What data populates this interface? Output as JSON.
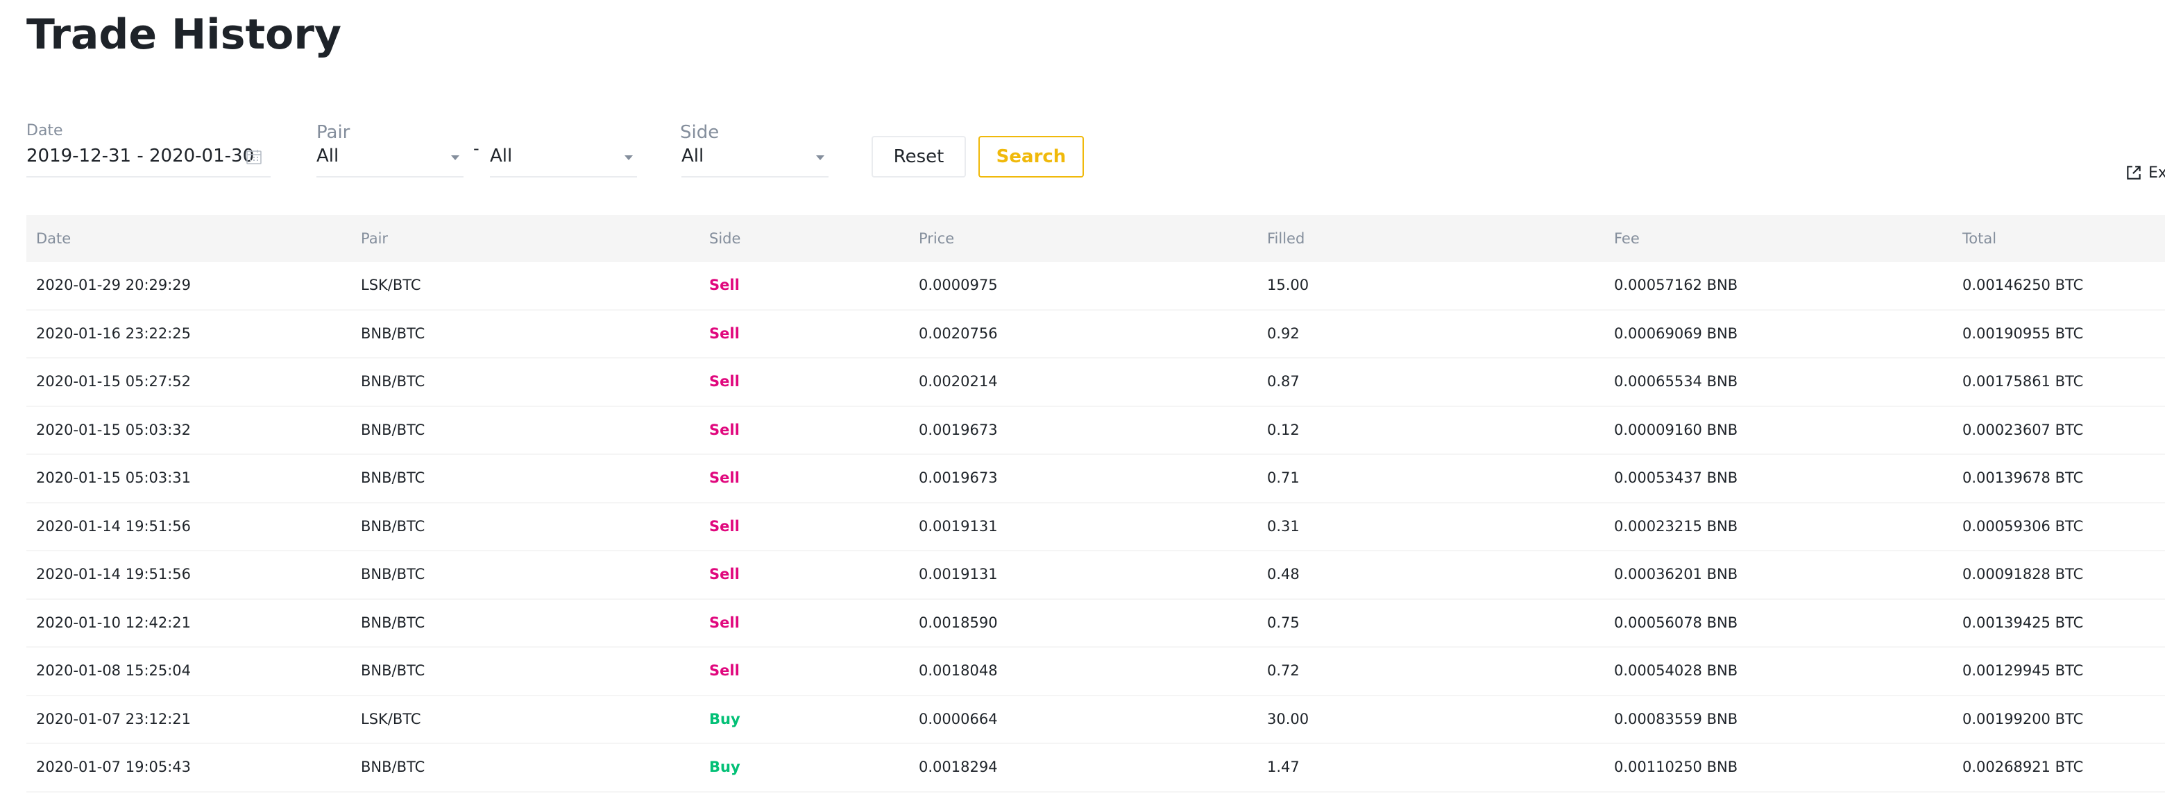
{
  "page_title": "Trade History",
  "filters": {
    "date_label": "Date",
    "date_value": "2019-12-31 - 2020-01-30",
    "pair_label": "Pair",
    "pair_base_value": "All",
    "pair_separator": "-",
    "pair_quote_value": "All",
    "side_label": "Side",
    "side_value": "All",
    "reset_label": "Reset",
    "search_label": "Search",
    "export_label": "Ex"
  },
  "colors": {
    "sell": "#e0077d",
    "buy": "#02c076",
    "accent": "#f0b90b"
  },
  "table": {
    "headers": [
      "Date",
      "Pair",
      "Side",
      "Price",
      "Filled",
      "Fee",
      "Total"
    ],
    "rows": [
      {
        "date": "2020-01-29 20:29:29",
        "pair": "LSK/BTC",
        "side": "Sell",
        "price": "0.0000975",
        "filled": "15.00",
        "fee": "0.00057162 BNB",
        "total": "0.00146250 BTC"
      },
      {
        "date": "2020-01-16 23:22:25",
        "pair": "BNB/BTC",
        "side": "Sell",
        "price": "0.0020756",
        "filled": "0.92",
        "fee": "0.00069069 BNB",
        "total": "0.00190955 BTC"
      },
      {
        "date": "2020-01-15 05:27:52",
        "pair": "BNB/BTC",
        "side": "Sell",
        "price": "0.0020214",
        "filled": "0.87",
        "fee": "0.00065534 BNB",
        "total": "0.00175861 BTC"
      },
      {
        "date": "2020-01-15 05:03:32",
        "pair": "BNB/BTC",
        "side": "Sell",
        "price": "0.0019673",
        "filled": "0.12",
        "fee": "0.00009160 BNB",
        "total": "0.00023607 BTC"
      },
      {
        "date": "2020-01-15 05:03:31",
        "pair": "BNB/BTC",
        "side": "Sell",
        "price": "0.0019673",
        "filled": "0.71",
        "fee": "0.00053437 BNB",
        "total": "0.00139678 BTC"
      },
      {
        "date": "2020-01-14 19:51:56",
        "pair": "BNB/BTC",
        "side": "Sell",
        "price": "0.0019131",
        "filled": "0.31",
        "fee": "0.00023215 BNB",
        "total": "0.00059306 BTC"
      },
      {
        "date": "2020-01-14 19:51:56",
        "pair": "BNB/BTC",
        "side": "Sell",
        "price": "0.0019131",
        "filled": "0.48",
        "fee": "0.00036201 BNB",
        "total": "0.00091828 BTC"
      },
      {
        "date": "2020-01-10 12:42:21",
        "pair": "BNB/BTC",
        "side": "Sell",
        "price": "0.0018590",
        "filled": "0.75",
        "fee": "0.00056078 BNB",
        "total": "0.00139425 BTC"
      },
      {
        "date": "2020-01-08 15:25:04",
        "pair": "BNB/BTC",
        "side": "Sell",
        "price": "0.0018048",
        "filled": "0.72",
        "fee": "0.00054028 BNB",
        "total": "0.00129945 BTC"
      },
      {
        "date": "2020-01-07 23:12:21",
        "pair": "LSK/BTC",
        "side": "Buy",
        "price": "0.0000664",
        "filled": "30.00",
        "fee": "0.00083559 BNB",
        "total": "0.00199200 BTC"
      },
      {
        "date": "2020-01-07 19:05:43",
        "pair": "BNB/BTC",
        "side": "Buy",
        "price": "0.0018294",
        "filled": "1.47",
        "fee": "0.00110250 BNB",
        "total": "0.00268921 BTC"
      }
    ]
  }
}
